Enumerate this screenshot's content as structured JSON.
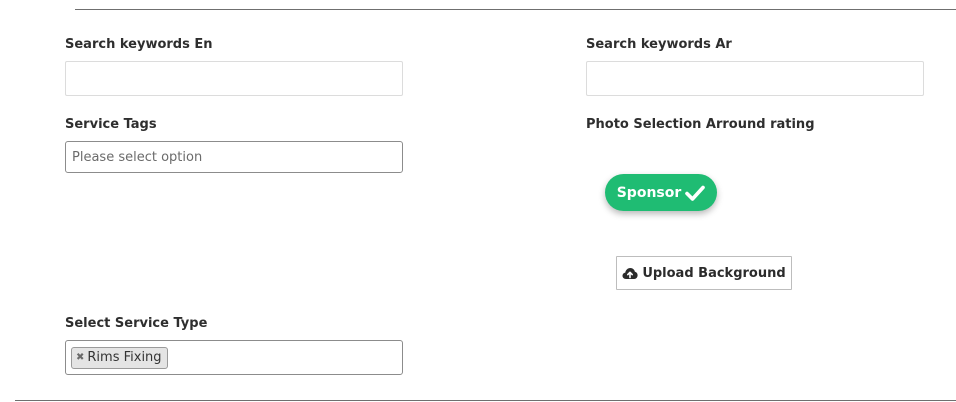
{
  "form": {
    "search_keywords_en": {
      "label": "Search keywords En",
      "value": "",
      "placeholder": ""
    },
    "search_keywords_ar": {
      "label": "Search keywords Ar",
      "value": "",
      "placeholder": ""
    },
    "service_tags": {
      "label": "Service Tags",
      "placeholder": "Please select option"
    },
    "photo_selection": {
      "label": "Photo Selection Arround rating"
    },
    "sponsor_button": {
      "label": "Sponsor",
      "icon": "checkmark-icon",
      "color": "#1fbc73"
    },
    "upload_background_button": {
      "label": "Upload Background",
      "icon": "cloud-upload-icon"
    },
    "service_type": {
      "label": "Select Service Type",
      "selected": [
        {
          "label": "Rims Fixing",
          "remove_icon": "close-icon"
        }
      ]
    }
  }
}
